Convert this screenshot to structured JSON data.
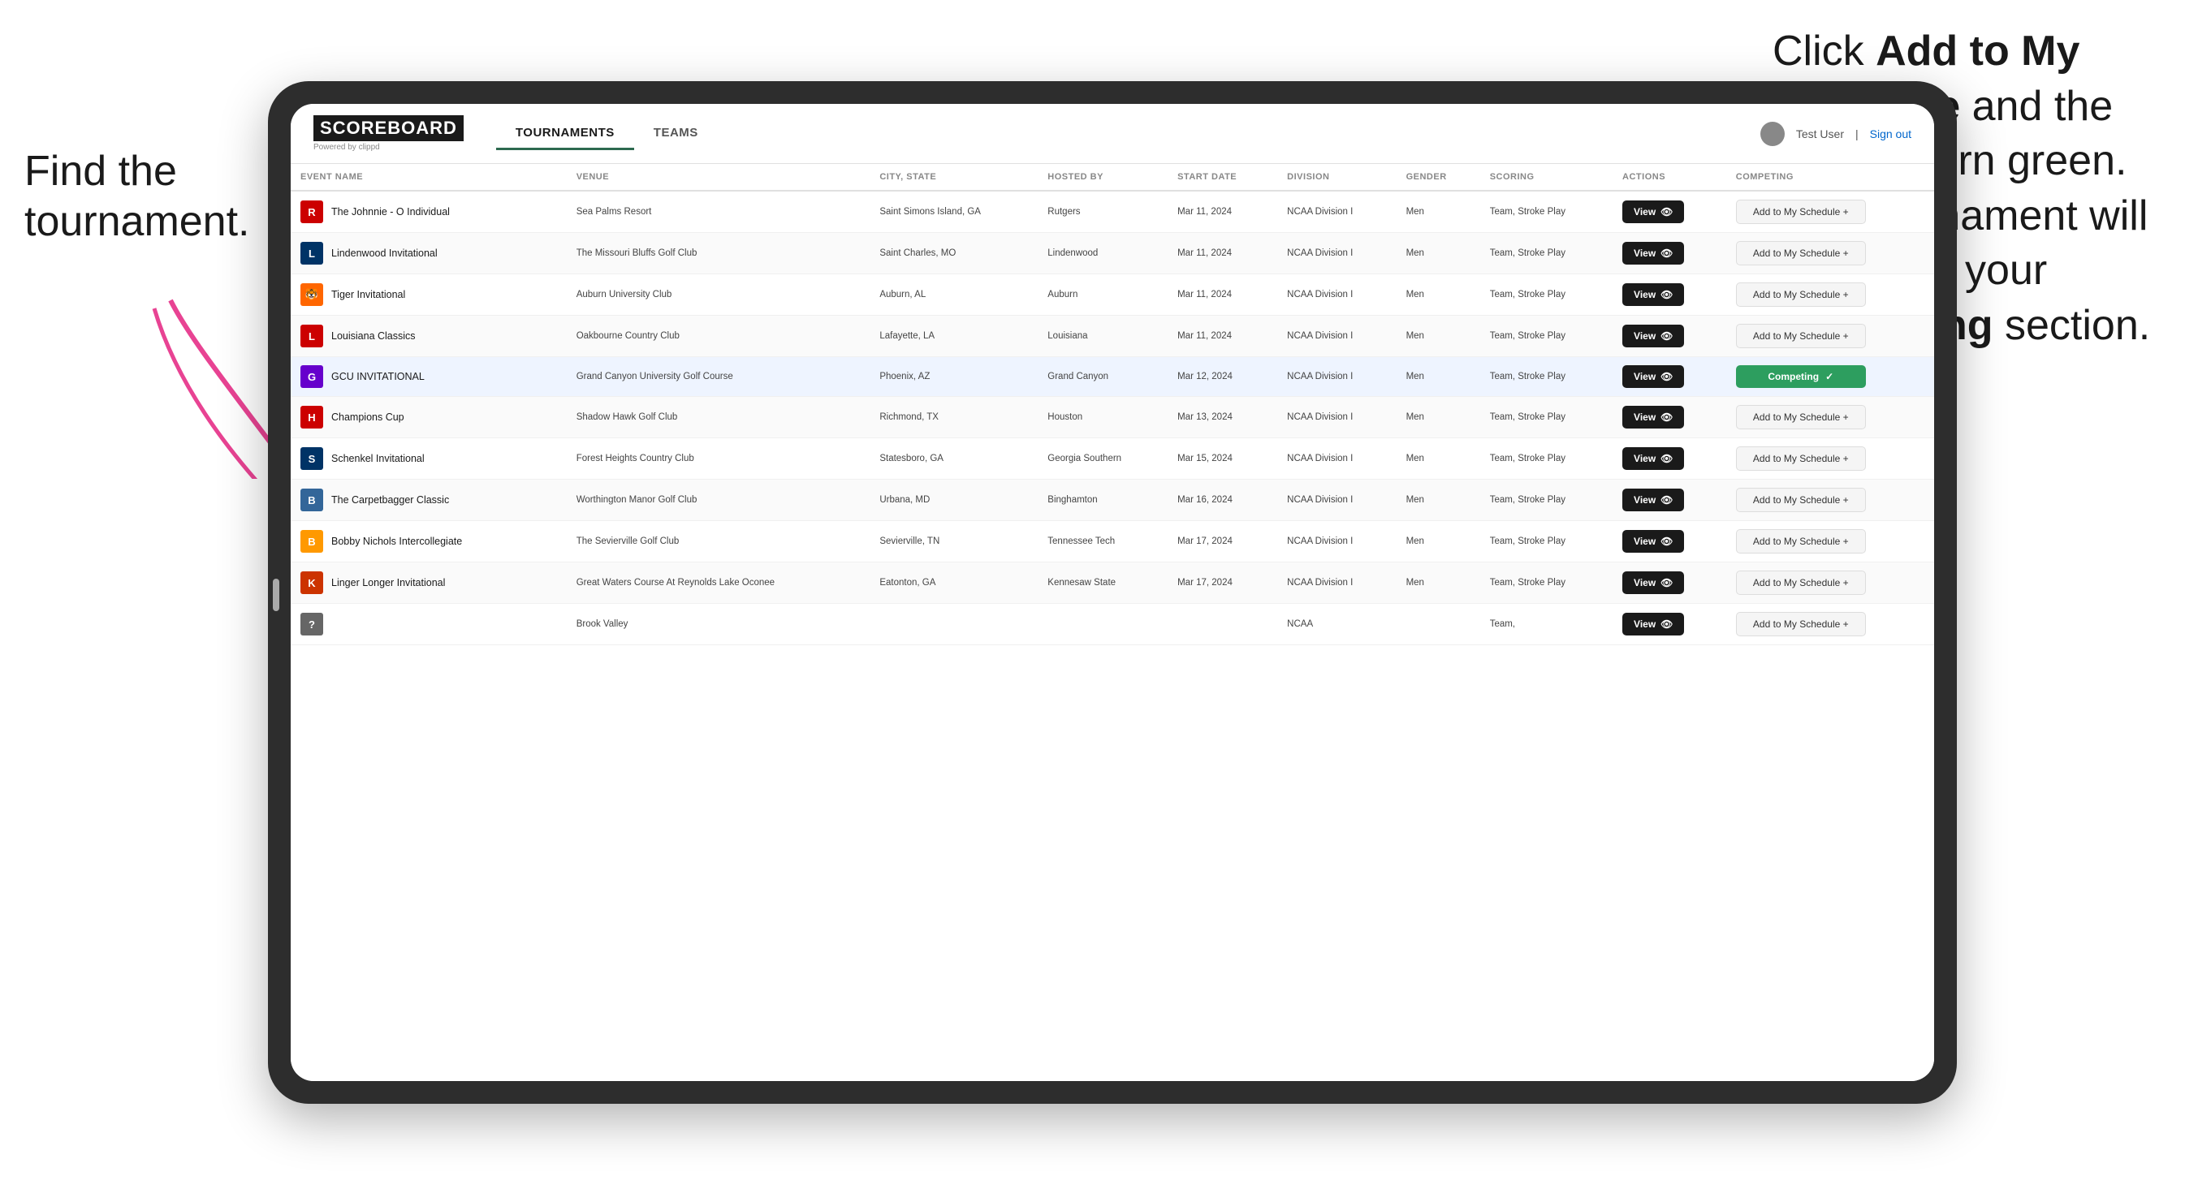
{
  "annotations": {
    "left_title": "Find the tournament.",
    "right_text_1": "Click ",
    "right_bold_1": "Add to My Schedule",
    "right_text_2": " and the box will turn green. This tournament will now be in your ",
    "right_bold_2": "Competing",
    "right_text_3": " section."
  },
  "app": {
    "logo": "SCOREBOARD",
    "logo_sub": "Powered by clippd",
    "nav": [
      "TOURNAMENTS",
      "TEAMS"
    ],
    "active_nav": "TOURNAMENTS",
    "user": "Test User",
    "signout": "Sign out"
  },
  "table": {
    "columns": [
      "EVENT NAME",
      "VENUE",
      "CITY, STATE",
      "HOSTED BY",
      "START DATE",
      "DIVISION",
      "GENDER",
      "SCORING",
      "ACTIONS",
      "COMPETING"
    ],
    "rows": [
      {
        "logo_color": "#cc0000",
        "logo_text": "R",
        "name": "The Johnnie - O Individual",
        "venue": "Sea Palms Resort",
        "city_state": "Saint Simons Island, GA",
        "hosted_by": "Rutgers",
        "start_date": "Mar 11, 2024",
        "division": "NCAA Division I",
        "gender": "Men",
        "scoring": "Team, Stroke Play",
        "action": "View",
        "competing_status": "add",
        "competing_label": "Add to My Schedule +",
        "highlighted": false
      },
      {
        "logo_color": "#003366",
        "logo_text": "L",
        "name": "Lindenwood Invitational",
        "venue": "The Missouri Bluffs Golf Club",
        "city_state": "Saint Charles, MO",
        "hosted_by": "Lindenwood",
        "start_date": "Mar 11, 2024",
        "division": "NCAA Division I",
        "gender": "Men",
        "scoring": "Team, Stroke Play",
        "action": "View",
        "competing_status": "add",
        "competing_label": "Add to My Schedule +",
        "highlighted": false
      },
      {
        "logo_color": "#ff6600",
        "logo_text": "🐯",
        "name": "Tiger Invitational",
        "venue": "Auburn University Club",
        "city_state": "Auburn, AL",
        "hosted_by": "Auburn",
        "start_date": "Mar 11, 2024",
        "division": "NCAA Division I",
        "gender": "Men",
        "scoring": "Team, Stroke Play",
        "action": "View",
        "competing_status": "add",
        "competing_label": "Add to My Schedule +",
        "highlighted": false
      },
      {
        "logo_color": "#cc0000",
        "logo_text": "L",
        "name": "Louisiana Classics",
        "venue": "Oakbourne Country Club",
        "city_state": "Lafayette, LA",
        "hosted_by": "Louisiana",
        "start_date": "Mar 11, 2024",
        "division": "NCAA Division I",
        "gender": "Men",
        "scoring": "Team, Stroke Play",
        "action": "View",
        "competing_status": "add",
        "competing_label": "Add to My Schedule +",
        "highlighted": false
      },
      {
        "logo_color": "#6600cc",
        "logo_text": "G",
        "name": "GCU INVITATIONAL",
        "venue": "Grand Canyon University Golf Course",
        "city_state": "Phoenix, AZ",
        "hosted_by": "Grand Canyon",
        "start_date": "Mar 12, 2024",
        "division": "NCAA Division I",
        "gender": "Men",
        "scoring": "Team, Stroke Play",
        "action": "View",
        "competing_status": "competing",
        "competing_label": "Competing ✓",
        "highlighted": true
      },
      {
        "logo_color": "#cc0000",
        "logo_text": "H",
        "name": "Champions Cup",
        "venue": "Shadow Hawk Golf Club",
        "city_state": "Richmond, TX",
        "hosted_by": "Houston",
        "start_date": "Mar 13, 2024",
        "division": "NCAA Division I",
        "gender": "Men",
        "scoring": "Team, Stroke Play",
        "action": "View",
        "competing_status": "add",
        "competing_label": "Add to My Schedule +",
        "highlighted": false
      },
      {
        "logo_color": "#003366",
        "logo_text": "S",
        "name": "Schenkel Invitational",
        "venue": "Forest Heights Country Club",
        "city_state": "Statesboro, GA",
        "hosted_by": "Georgia Southern",
        "start_date": "Mar 15, 2024",
        "division": "NCAA Division I",
        "gender": "Men",
        "scoring": "Team, Stroke Play",
        "action": "View",
        "competing_status": "add",
        "competing_label": "Add to My Schedule +",
        "highlighted": false
      },
      {
        "logo_color": "#336699",
        "logo_text": "B",
        "name": "The Carpetbagger Classic",
        "venue": "Worthington Manor Golf Club",
        "city_state": "Urbana, MD",
        "hosted_by": "Binghamton",
        "start_date": "Mar 16, 2024",
        "division": "NCAA Division I",
        "gender": "Men",
        "scoring": "Team, Stroke Play",
        "action": "View",
        "competing_status": "add",
        "competing_label": "Add to My Schedule +",
        "highlighted": false
      },
      {
        "logo_color": "#ff9900",
        "logo_text": "B",
        "name": "Bobby Nichols Intercollegiate",
        "venue": "The Sevierville Golf Club",
        "city_state": "Sevierville, TN",
        "hosted_by": "Tennessee Tech",
        "start_date": "Mar 17, 2024",
        "division": "NCAA Division I",
        "gender": "Men",
        "scoring": "Team, Stroke Play",
        "action": "View",
        "competing_status": "add",
        "competing_label": "Add to My Schedule +",
        "highlighted": false
      },
      {
        "logo_color": "#cc3300",
        "logo_text": "K",
        "name": "Linger Longer Invitational",
        "venue": "Great Waters Course At Reynolds Lake Oconee",
        "city_state": "Eatonton, GA",
        "hosted_by": "Kennesaw State",
        "start_date": "Mar 17, 2024",
        "division": "NCAA Division I",
        "gender": "Men",
        "scoring": "Team, Stroke Play",
        "action": "View",
        "competing_status": "add",
        "competing_label": "Add to My Schedule +",
        "highlighted": false
      },
      {
        "logo_color": "#666666",
        "logo_text": "?",
        "name": "",
        "venue": "Brook Valley",
        "city_state": "",
        "hosted_by": "",
        "start_date": "",
        "division": "NCAA",
        "gender": "",
        "scoring": "Team,",
        "action": "View",
        "competing_status": "add",
        "competing_label": "Add to My Schedule +",
        "highlighted": false
      }
    ]
  }
}
